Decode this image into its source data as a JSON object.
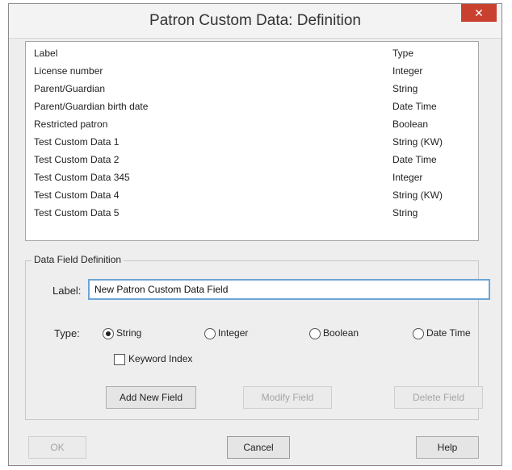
{
  "window": {
    "title": "Patron Custom Data: Definition",
    "close_label": "✕"
  },
  "list": {
    "headers": {
      "label": "Label",
      "type": "Type"
    },
    "rows": [
      {
        "label": "License number",
        "type": "Integer"
      },
      {
        "label": "Parent/Guardian",
        "type": "String"
      },
      {
        "label": "Parent/Guardian birth date",
        "type": "Date Time"
      },
      {
        "label": "Restricted patron",
        "type": "Boolean"
      },
      {
        "label": "Test Custom Data 1",
        "type": "String (KW)"
      },
      {
        "label": "Test Custom Data 2",
        "type": "Date Time"
      },
      {
        "label": "Test Custom Data 345",
        "type": "Integer"
      },
      {
        "label": "Test Custom Data 4",
        "type": "String (KW)"
      },
      {
        "label": "Test Custom Data 5",
        "type": "String"
      }
    ]
  },
  "definition": {
    "group_title": "Data Field Definition",
    "label_caption": "Label:",
    "label_value": "New Patron Custom Data Field",
    "type_caption": "Type:",
    "types": [
      {
        "label": "String",
        "checked": true
      },
      {
        "label": "Integer",
        "checked": false
      },
      {
        "label": "Boolean",
        "checked": false
      },
      {
        "label": "Date Time",
        "checked": false
      }
    ],
    "keyword_index_label": "Keyword Index",
    "keyword_index_checked": false,
    "add_button": "Add New Field",
    "modify_button": "Modify Field",
    "delete_button": "Delete Field"
  },
  "footer": {
    "ok_button": "OK",
    "cancel_button": "Cancel",
    "help_button": "Help"
  },
  "colors": {
    "close_button_bg": "#c9402f",
    "input_focus_border": "#6aa5d8",
    "disabled_text": "#a5a5a5"
  }
}
